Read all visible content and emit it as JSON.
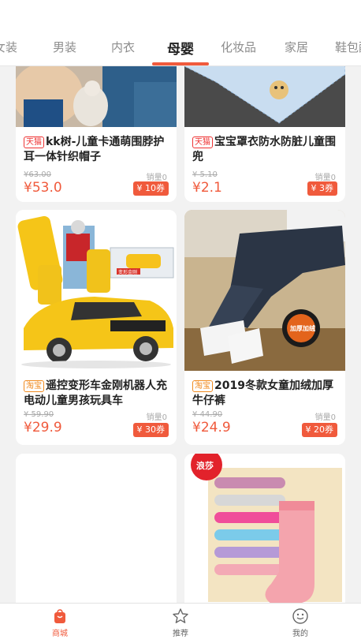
{
  "tabs": [
    "女装",
    "男装",
    "内衣",
    "母婴",
    "化妆品",
    "家居",
    "鞋包配"
  ],
  "active_tab": "母婴",
  "products": [
    {
      "badge": "天猫",
      "title": "kk树-儿童卡通萌围脖护耳一体针织帽子",
      "original_price": "¥63.00",
      "sales": "销量0",
      "price": "¥53.0",
      "coupon": "¥ 10券"
    },
    {
      "badge": "天猫",
      "title": "宝宝罩衣防水防脏儿童围兜",
      "original_price": "¥ 5.10",
      "sales": "销量0",
      "price": "¥2.1",
      "coupon": "¥ 3券"
    },
    {
      "badge": "淘宝",
      "title": "遥控变形车金刚机器人充电动儿童男孩玩具车",
      "original_price": "¥ 59.90",
      "sales": "销量0",
      "price": "¥29.9",
      "coupon": "¥ 30券"
    },
    {
      "badge": "淘宝",
      "title": "2019冬款女童加绒加厚牛仔裤",
      "original_price": "¥ 44.90",
      "sales": "销量0",
      "price": "¥24.9",
      "coupon": "¥ 20券"
    }
  ],
  "image_text": {
    "toy_box": "变形金刚",
    "jeans_label": "加厚加绒",
    "sock_brand": "浪莎"
  },
  "bottom_nav": {
    "shop": "商城",
    "recommend": "推荐",
    "mine": "我的"
  },
  "colors": {
    "accent": "#f05a3c",
    "tmall": "#ee3333",
    "taobao": "#f08a1f"
  }
}
